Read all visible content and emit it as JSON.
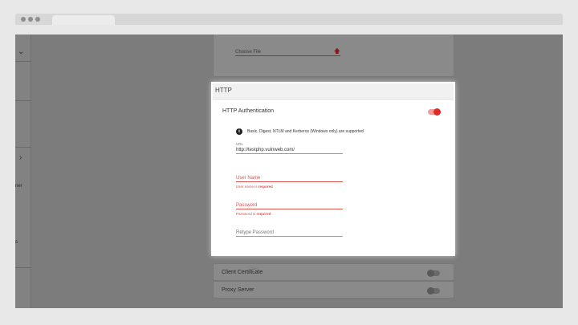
{
  "dim_card": {
    "file_field_placeholder": "Choose File",
    "upload_icon": "upload-arrow-icon"
  },
  "http": {
    "title": "HTTP",
    "auth_label": "HTTP Authentication",
    "auth_enabled": true,
    "info_icon": "info-icon",
    "info_text": "Basic, Digest, NTLM and Kerberos (Windows only) are supported",
    "url": {
      "label": "URL",
      "value": "http://testphp.vulnweb.com/"
    },
    "username": {
      "placeholder": "User Name",
      "error_prefix": "User name is ",
      "error_strong": "required"
    },
    "password": {
      "placeholder": "Password",
      "error_prefix": "Password is ",
      "error_strong": "required"
    },
    "retype": {
      "placeholder": "Retype Password"
    }
  },
  "below": {
    "client_certificate_label": "Client Certificate",
    "proxy_server_label": "Proxy Server"
  },
  "sidebar": {
    "fragment_1": "ner",
    "fragment_2": "s"
  },
  "colors": {
    "accent": "#e02b2b",
    "error": "#d9534f",
    "overlay": "#7c7c7c"
  }
}
